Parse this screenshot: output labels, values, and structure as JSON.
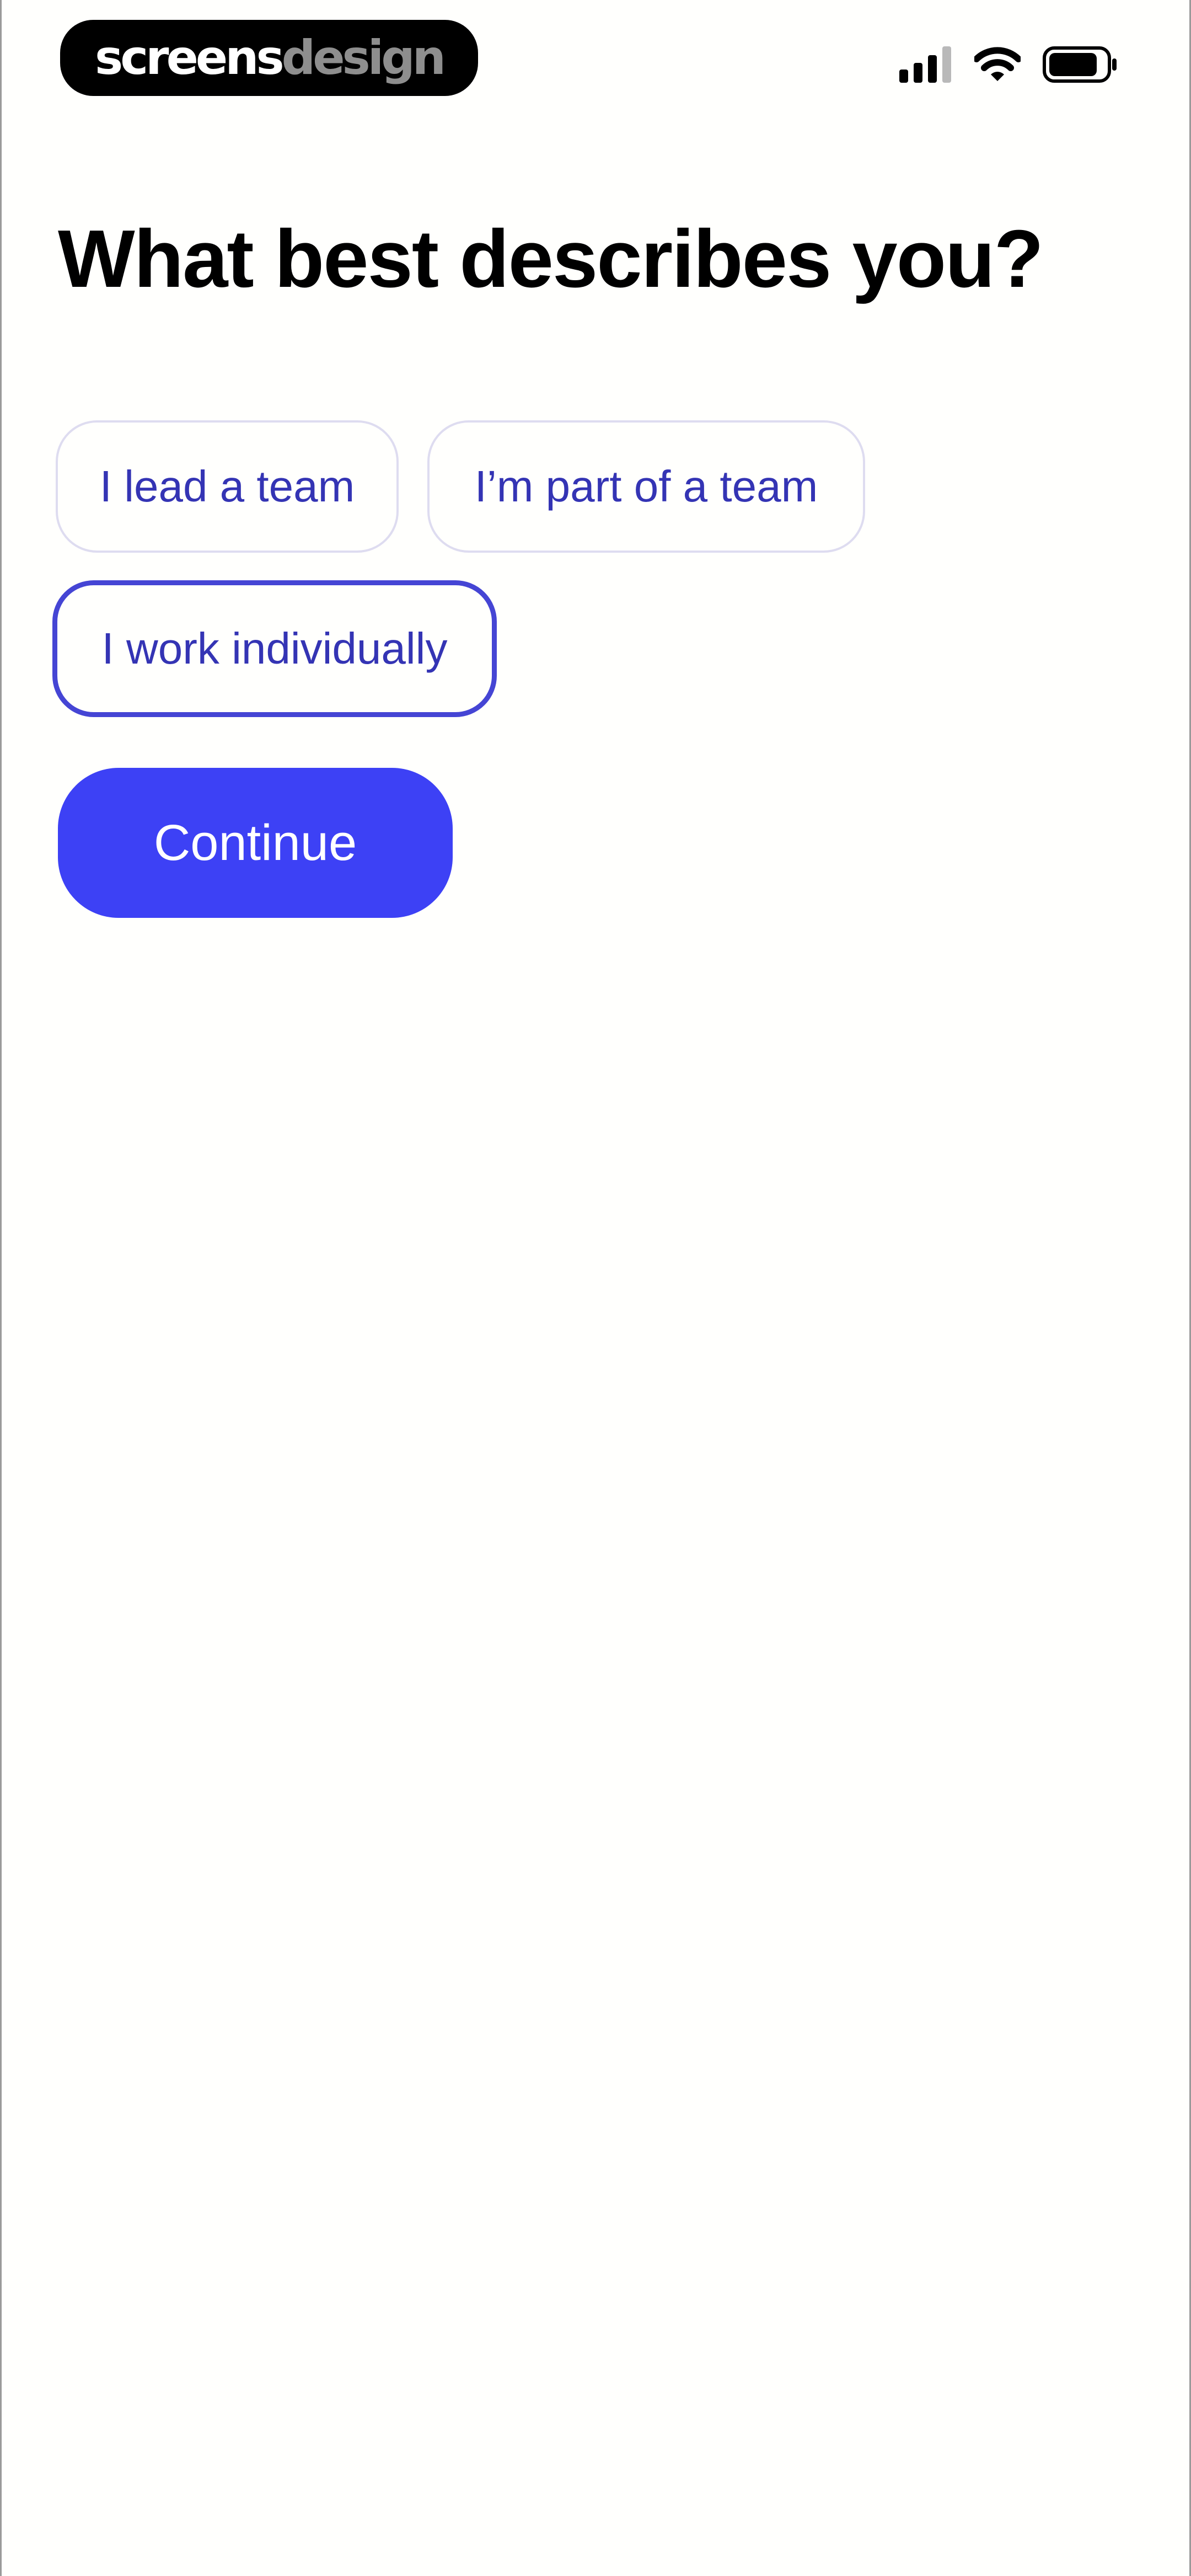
{
  "status_bar": {
    "brand_part1": "screens",
    "brand_part2": "design",
    "icons": [
      "cellular-signal-icon",
      "wifi-icon",
      "battery-icon"
    ]
  },
  "question": {
    "title": "What best describes you?"
  },
  "options": [
    {
      "label": "I lead a team",
      "selected": false
    },
    {
      "label": "I’m part of a team",
      "selected": false
    },
    {
      "label": "I work individually",
      "selected": true
    }
  ],
  "actions": {
    "continue_label": "Continue"
  },
  "colors": {
    "accent": "#3d41f5",
    "chip_text": "#3434b4",
    "chip_border": "#dedcf0",
    "chip_selected_border": "#4545d4",
    "background": "#fffffd"
  }
}
